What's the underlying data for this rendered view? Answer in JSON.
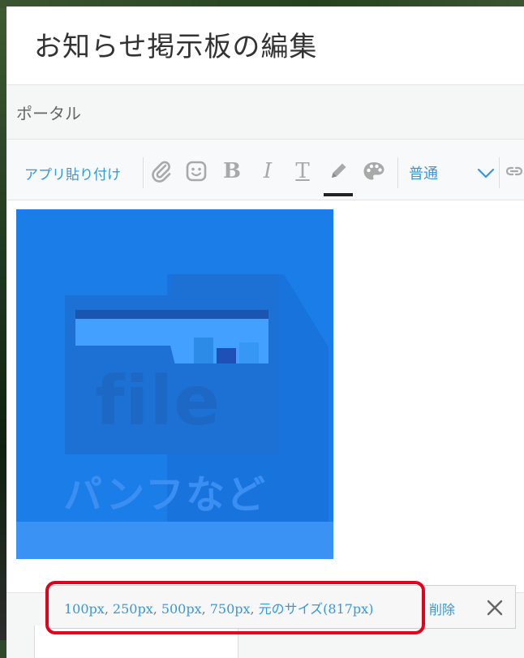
{
  "dialog": {
    "title": "お知らせ掲示板の編集",
    "subheader": "ポータル"
  },
  "toolbar": {
    "paste_label": "アプリ貼り付け",
    "buttons": [
      {
        "name": "attachment",
        "icon": "paperclip-icon"
      },
      {
        "name": "emoji",
        "icon": "smiley-icon"
      },
      {
        "name": "bold",
        "label": "B"
      },
      {
        "name": "italic",
        "label": "I"
      },
      {
        "name": "text-format",
        "label": "T"
      },
      {
        "name": "text-color",
        "icon": "pencil-icon"
      },
      {
        "name": "background-color",
        "icon": "palette-icon"
      }
    ],
    "font_size": {
      "selected": "普通"
    },
    "link_icon": "link-icon",
    "accent_color": "#3498db",
    "icon_color": "#a9a9a9"
  },
  "editor": {
    "image": {
      "word": "file",
      "caption": "パンフなど",
      "background_color": "#1a7de8"
    }
  },
  "resize_bar": {
    "options": [
      "100px",
      "250px",
      "500px",
      "750px",
      "元のサイズ(817px)"
    ],
    "separator": ",",
    "delete_label": "削除",
    "close_icon": "close-icon",
    "highlight_color": "#e4001b"
  }
}
